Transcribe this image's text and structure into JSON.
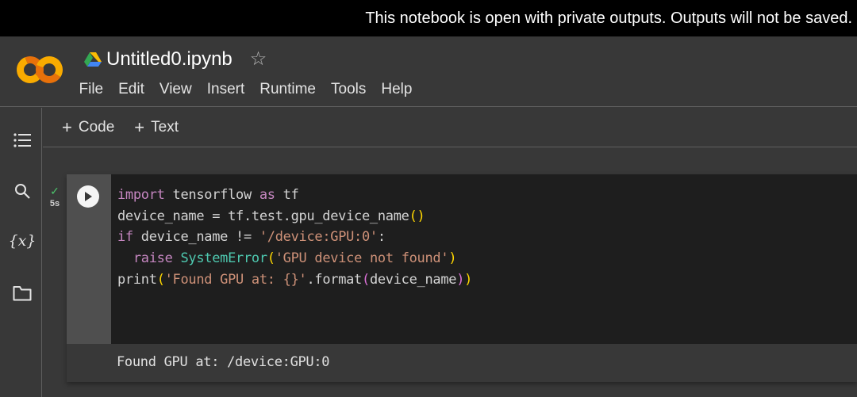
{
  "banner": {
    "message": "This notebook is open with private outputs. Outputs will not be saved."
  },
  "header": {
    "logo": "colab-logo",
    "notebook_title": "Untitled0.ipynb",
    "drive_icon": "google-drive-icon",
    "star_icon": "star-icon",
    "menu": [
      {
        "label": "File"
      },
      {
        "label": "Edit"
      },
      {
        "label": "View"
      },
      {
        "label": "Insert"
      },
      {
        "label": "Runtime"
      },
      {
        "label": "Tools"
      },
      {
        "label": "Help"
      }
    ]
  },
  "sidebar": {
    "items": [
      {
        "icon": "table-of-contents-icon"
      },
      {
        "icon": "search-icon"
      },
      {
        "icon": "variables-icon",
        "glyph": "{x}"
      },
      {
        "icon": "folder-icon"
      }
    ]
  },
  "toolbar": {
    "add_code_label": "Code",
    "add_text_label": "Text",
    "plus_glyph": "+"
  },
  "cell": {
    "status_icon": "check-icon",
    "status_glyph": "✓",
    "exec_time": "5s",
    "code_lines": [
      "import tensorflow as tf",
      "device_name = tf.test.gpu_device_name()",
      "if device_name != '/device:GPU:0':",
      "  raise SystemError('GPU device not found')",
      "print('Found GPU at: {}'.format(device_name))"
    ],
    "tokens": {
      "l1": {
        "kw1": "import",
        "t1": " tensorflow ",
        "kw2": "as",
        "t2": " tf"
      },
      "l2": {
        "t1": "device_name = tf.test.gpu_device_name",
        "p1": "(",
        "p2": ")"
      },
      "l3": {
        "kw1": "if",
        "t1": " device_name != ",
        "s1": "'/device:GPU:0'",
        "t2": ":"
      },
      "l4": {
        "indent": "  ",
        "kw1": "raise",
        "t1": " ",
        "c1": "SystemError",
        "p1": "(",
        "s1": "'GPU device not found'",
        "p2": ")"
      },
      "l5": {
        "t1": "print",
        "p1": "(",
        "s1": "'Found GPU at: {}'",
        "t2": ".format",
        "q1": "(",
        "t3": "device_name",
        "q2": ")",
        "p2": ")"
      }
    },
    "output": "Found GPU at: /device:GPU:0"
  },
  "colors": {
    "keyword": "#c586c0",
    "string": "#ce9178",
    "class": "#4ec9b0",
    "bracket": "#ffd700",
    "success": "#4cc36b",
    "logo_orange": "#f9ab00",
    "logo_dark_orange": "#e8710a"
  }
}
